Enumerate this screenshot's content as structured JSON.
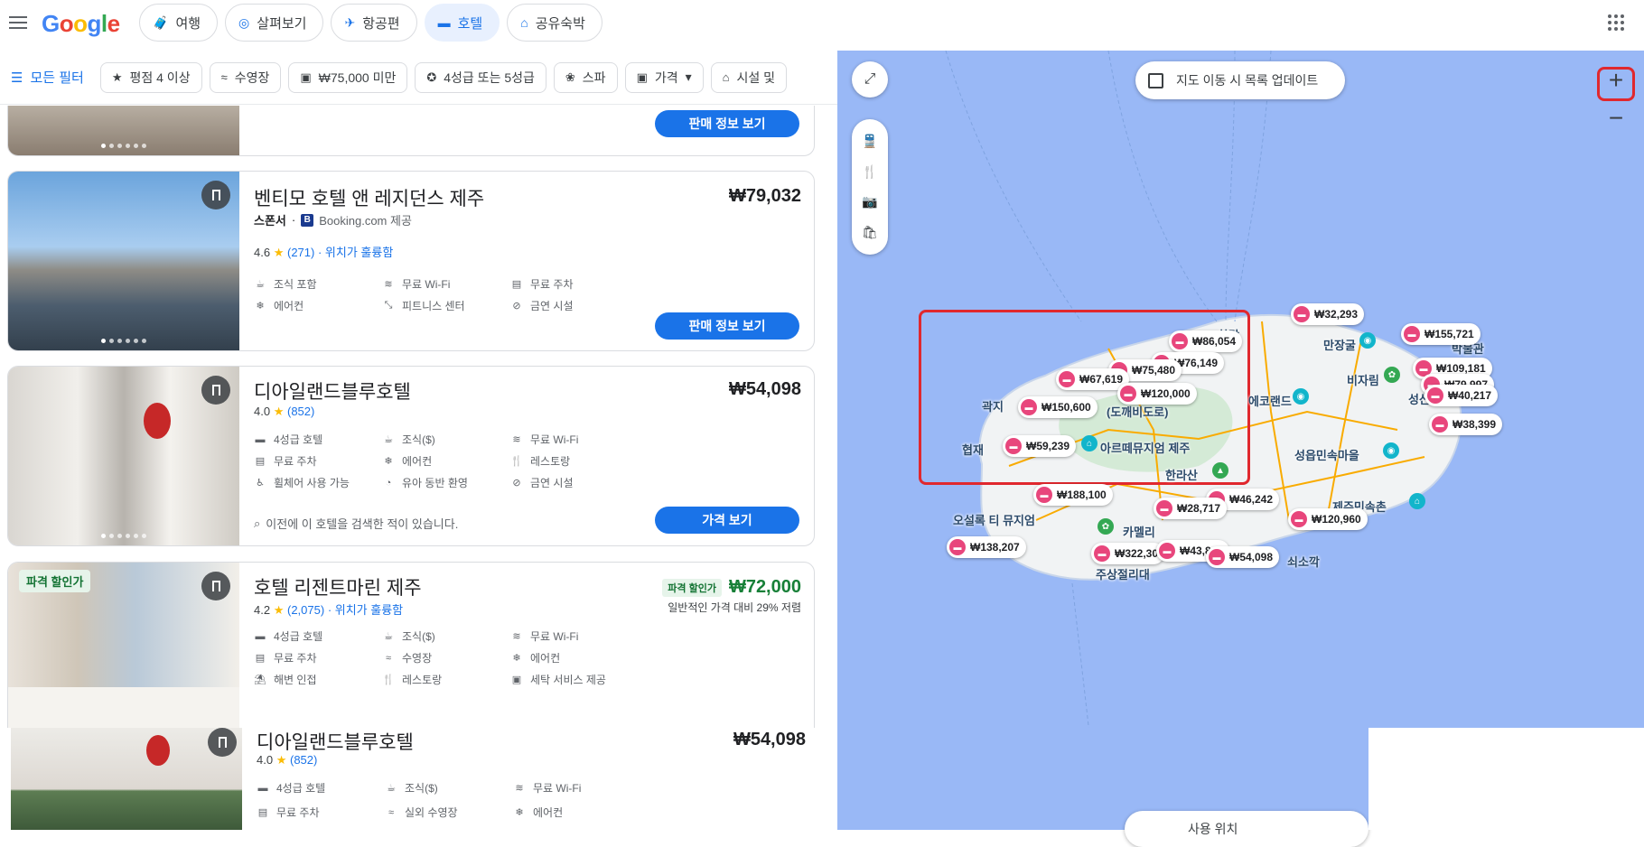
{
  "logo": "Google",
  "tabs": [
    {
      "label": "여행",
      "icon": "luggage-icon"
    },
    {
      "label": "살펴보기",
      "icon": "explore-icon"
    },
    {
      "label": "항공편",
      "icon": "flight-icon"
    },
    {
      "label": "호텔",
      "icon": "hotel-icon"
    },
    {
      "label": "공유숙박",
      "icon": "home-icon"
    }
  ],
  "filters": {
    "all": "모든 필터",
    "chips": [
      "평점 4 이상",
      "수영장",
      "₩75,000 미만",
      "4성급 또는 5성급",
      "스파",
      "가격",
      "시설 및"
    ]
  },
  "cards": {
    "top": {
      "button": "판매 정보 보기"
    },
    "ventimo": {
      "name": "벤티모 호텔 앤 레지던스 제주",
      "price": "₩79,032",
      "sponsor": "스폰서",
      "provider_badge": "B",
      "provider": "Booking.com 제공",
      "rating": "4.6",
      "reviews": "(271)",
      "location": "· 위치가 훌륭함",
      "amenities": [
        "조식 포함",
        "무료 Wi-Fi",
        "무료 주차",
        "에어컨",
        "피트니스 센터",
        "금연 시설"
      ],
      "button": "판매 정보 보기"
    },
    "dialand": {
      "name": "디아일랜드블루호텔",
      "price": "₩54,098",
      "rating": "4.0",
      "reviews": "(852)",
      "amenities": [
        "4성급 호텔",
        "조식($)",
        "무료 Wi-Fi",
        "무료 주차",
        "에어컨",
        "레스토랑",
        "휠체어 사용 가능",
        "유아 동반 환영",
        "금연 시설"
      ],
      "searched": "이전에 이 호텔을 검색한 적이 있습니다.",
      "button": "가격 보기"
    },
    "regent": {
      "deal_tag": "파격 할인가",
      "name": "호텔 리젠트마린 제주",
      "price_tag": "파격 할인가",
      "price": "₩72,000",
      "price_sub": "일반적인 가격 대비 29% 저렴",
      "rating": "4.2",
      "reviews": "(2,075)",
      "location": "· 위치가 훌륭함",
      "amenities": [
        "4성급 호텔",
        "조식($)",
        "무료 Wi-Fi",
        "무료 주차",
        "수영장",
        "에어컨",
        "해변 인접",
        "레스토랑",
        "세탁 서비스 제공"
      ]
    },
    "overlay": {
      "name": "디아일랜드블루호텔",
      "price": "₩54,098",
      "rating": "4.0",
      "reviews": "(852)",
      "amenities": [
        "4성급 호텔",
        "조식($)",
        "무료 Wi-Fi",
        "무료 주차",
        "실외 수영장",
        "에어컨"
      ]
    }
  },
  "map": {
    "toggle": "지도 이동 시 목록 업데이트",
    "labels": [
      "만장굴",
      "비자림",
      "에코랜드",
      "성읍민속마을",
      "제주민속촌",
      "아르떼뮤지엄 제주",
      "한라산",
      "(도깨비도로)",
      "오설록 티 뮤지엄",
      "카멜리",
      "주상절리대",
      "쇠소깍",
      "협재",
      "곽지",
      "한담",
      "성산",
      "박물관"
    ],
    "pins": [
      "₩32,293",
      "₩86,054",
      "₩155,721",
      "₩76,149",
      "₩75,480",
      "₩67,619",
      "₩120,000",
      "₩109,181",
      "₩79,997",
      "₩40,217",
      "₩150,600",
      "₩38,399",
      "₩59,239",
      "₩188,100",
      "₩46,242",
      "₩28,717",
      "₩120,960",
      "₩138,207",
      "₩322,30",
      "₩43,844",
      "₩54,098"
    ],
    "bottom_search": "사용 위치"
  },
  "colors": {
    "accent": "#1a73e8",
    "highlight": "#e0282e",
    "pin": "#e8467c",
    "deal": "#188038"
  }
}
